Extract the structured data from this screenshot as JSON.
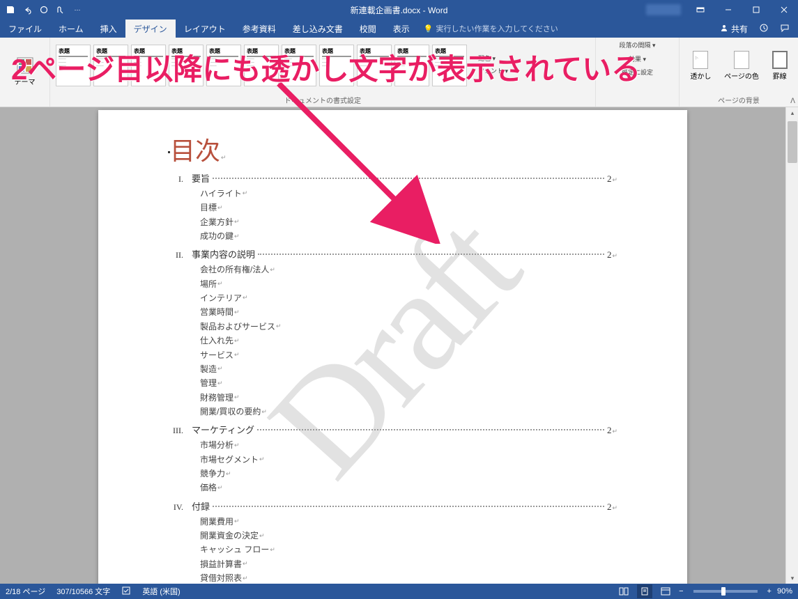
{
  "title": "新連載企画書.docx - Word",
  "menu": {
    "file": "ファイル",
    "home": "ホーム",
    "insert": "挿入",
    "design": "デザイン",
    "layout": "レイアウト",
    "references": "参考資料",
    "mailings": "差し込み文書",
    "review": "校閲",
    "view": "表示"
  },
  "tellme": "実行したい作業を入力してください",
  "share": "共有",
  "ribbon": {
    "themes_label": "テーマ",
    "doc_format_label": "ドキュメントの書式設定",
    "page_bg_label": "ページの背景",
    "title_style": "表題",
    "set_default": "既定に設定",
    "watermark": "透かし",
    "page_color": "ページの色",
    "page_border": "罫線"
  },
  "doc": {
    "toc_title": "目次",
    "watermark": "Draft",
    "sections": [
      {
        "num": "I.",
        "label": "要旨",
        "page": "2",
        "subs": [
          "ハイライト",
          "目標",
          "企業方針",
          "成功の鍵"
        ]
      },
      {
        "num": "II.",
        "label": "事業内容の説明",
        "page": "2",
        "subs": [
          "会社の所有権/法人",
          "場所",
          "インテリア",
          "営業時間",
          "製品およびサービス",
          "仕入れ先",
          "サービス",
          "製造",
          "管理",
          "財務管理",
          "開業/買収の要約"
        ]
      },
      {
        "num": "III.",
        "label": "マーケティング",
        "page": "2",
        "subs": [
          "市場分析",
          "市場セグメント",
          "競争力",
          "価格"
        ]
      },
      {
        "num": "IV.",
        "label": "付録",
        "page": "2",
        "subs": [
          "開業費用",
          "開業資金の決定",
          "キャッシュ フロー",
          "損益計算書",
          "貸借対照表"
        ]
      }
    ]
  },
  "status": {
    "page": "2/18 ページ",
    "words": "307/10566 文字",
    "lang": "英語 (米国)",
    "zoom": "90%"
  },
  "annotation": "2ページ目以降にも透かし文字が表示されている"
}
